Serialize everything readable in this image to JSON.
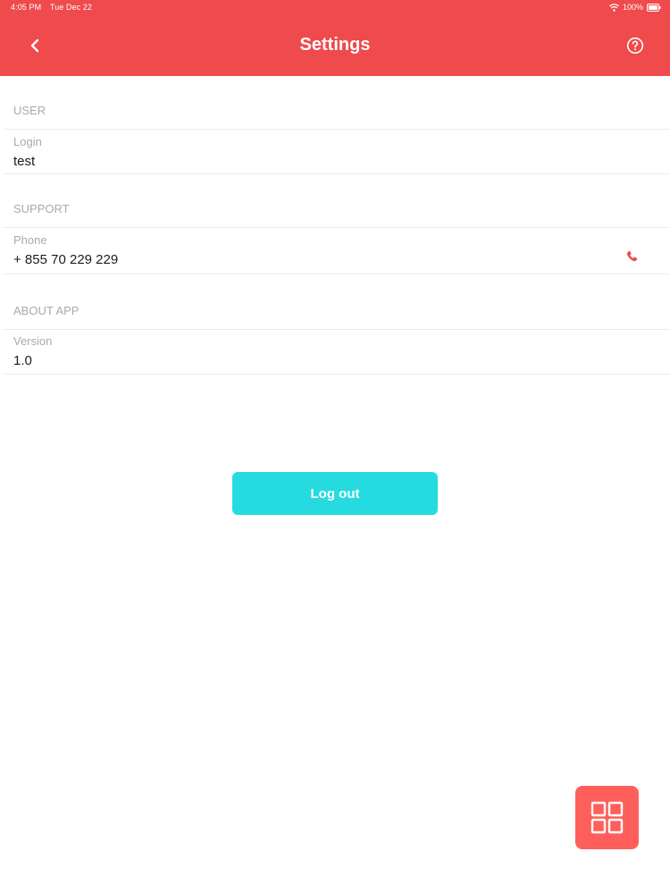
{
  "status_bar": {
    "time": "4:05 PM",
    "date": "Tue Dec 22",
    "battery": "100%",
    "wifi_icon": "wifi-icon",
    "battery_icon": "battery-icon"
  },
  "header": {
    "title": "Settings",
    "back_icon": "chevron-left-icon",
    "help_icon": "help-circle-icon",
    "background_color": "#ef4a4c"
  },
  "sections": [
    {
      "title": "USER",
      "rows": [
        {
          "label": "Login",
          "value": "test"
        }
      ]
    },
    {
      "title": "SUPPORT",
      "rows": [
        {
          "label": "Phone",
          "value": "+ 855 70 229 229",
          "action_icon": "phone-icon"
        }
      ]
    },
    {
      "title": "ABOUT APP",
      "rows": [
        {
          "label": "Version",
          "value": "1.0"
        }
      ]
    }
  ],
  "logout_button": {
    "label": "Log out",
    "color": "#26dbdf"
  },
  "fab": {
    "icon": "grid-icon",
    "color": "#ff5f5b"
  }
}
